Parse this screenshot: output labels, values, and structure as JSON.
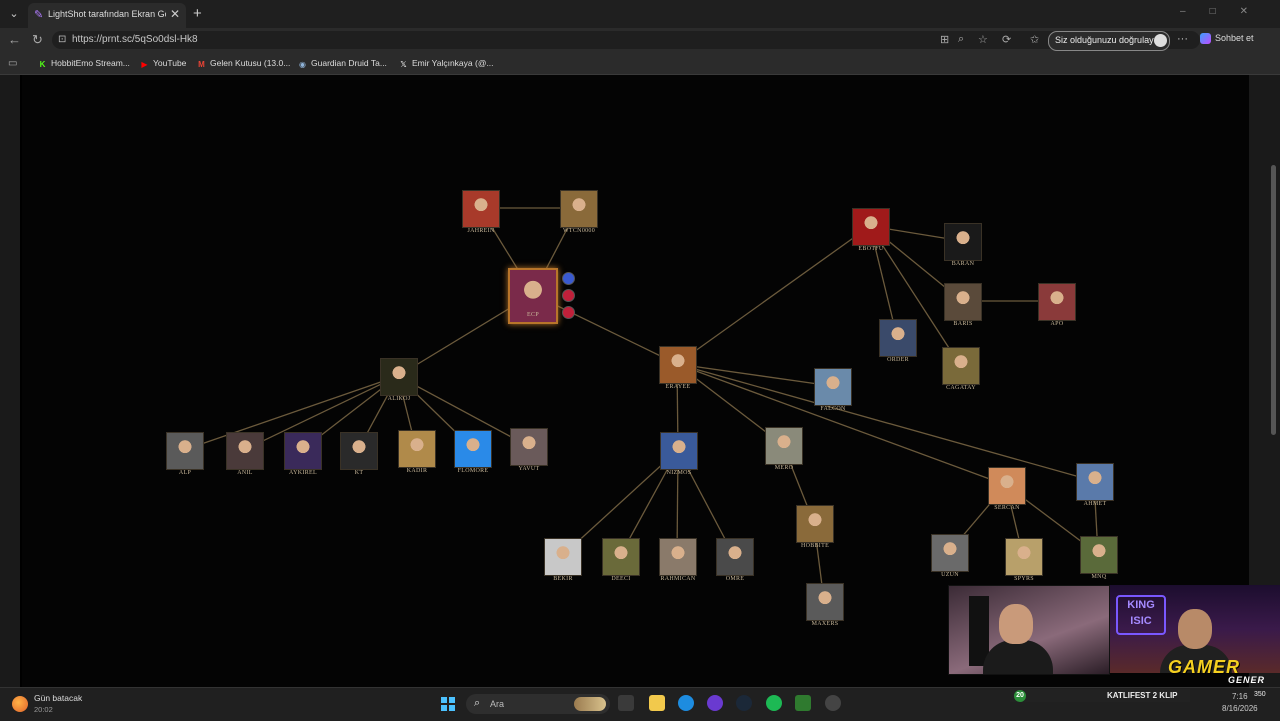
{
  "browser": {
    "tab_title": "LightShot tarafından Ekran Görüntüsü",
    "url": "https://prnt.sc/5qSo0dsl-Hk8",
    "profile_prompt": "Siz olduğunuzu doğrulayın",
    "copilot_label": "Sohbet et"
  },
  "bookmarks": [
    {
      "label": "HobbitEmo Stream...",
      "icon": "kick-icon",
      "color": "#53fc18"
    },
    {
      "label": "YouTube",
      "icon": "youtube-icon",
      "color": "#ff0000"
    },
    {
      "label": "Gelen Kutusu (13.0...",
      "icon": "gmail-icon",
      "color": "#ea4335"
    },
    {
      "label": "Guardian Druid Ta...",
      "icon": "guardian-icon",
      "color": "#8fb3d9"
    },
    {
      "label": "Emir Yalçınkaya (@...",
      "icon": "x-icon",
      "color": "#ffffff"
    }
  ],
  "graph": {
    "nodes": [
      {
        "id": "jahrein",
        "label": "JAHREIN",
        "color": "#a83a2a"
      },
      {
        "id": "wtcn",
        "label": "WTCN0000",
        "color": "#8a6a3a"
      },
      {
        "id": "ecp",
        "label": "ECP",
        "color": "#7a2a4a",
        "root": true
      },
      {
        "id": "alikoj",
        "label": "ALIKOJ",
        "color": "#2a2a1a"
      },
      {
        "id": "eray",
        "label": "ERAYEE",
        "color": "#9a5a2a"
      },
      {
        "id": "ebotfu",
        "label": "EBOTFU",
        "color": "#a01a1a"
      },
      {
        "id": "baran",
        "label": "BARAN",
        "color": "#1a1a1a"
      },
      {
        "id": "baris",
        "label": "BARIS",
        "color": "#5a4a3a"
      },
      {
        "id": "apo",
        "label": "APO",
        "color": "#8a3a3a"
      },
      {
        "id": "order",
        "label": "ORDER",
        "color": "#3a4a6a"
      },
      {
        "id": "cagatay",
        "label": "CAGATAY",
        "color": "#7a6a3a"
      },
      {
        "id": "falcon",
        "label": "FALCON",
        "color": "#6a8aaa"
      },
      {
        "id": "alp",
        "label": "ALP",
        "color": "#5a5a5a"
      },
      {
        "id": "anil",
        "label": "ANIL",
        "color": "#4a3a3a"
      },
      {
        "id": "aykirel",
        "label": "AYKIREL",
        "color": "#3a2a5a"
      },
      {
        "id": "kt",
        "label": "KT",
        "color": "#2a2a2a"
      },
      {
        "id": "kadir",
        "label": "KADIR",
        "color": "#b08a4a"
      },
      {
        "id": "flomore",
        "label": "FLOMORE",
        "color": "#2a8ae8"
      },
      {
        "id": "yavut",
        "label": "YAVUT",
        "color": "#6a5a5a"
      },
      {
        "id": "nizmos",
        "label": "NIZMOS",
        "color": "#3a5a9a"
      },
      {
        "id": "mero",
        "label": "MERO",
        "color": "#8a8a7a"
      },
      {
        "id": "sercan",
        "label": "SERCAN",
        "color": "#d08a5a"
      },
      {
        "id": "ahmet",
        "label": "AHMET",
        "color": "#5a7aaa"
      },
      {
        "id": "hobbit",
        "label": "HOBBITE",
        "color": "#8a6a3a"
      },
      {
        "id": "maxers",
        "label": "MAXERS",
        "color": "#5a5a5a"
      },
      {
        "id": "bekir",
        "label": "BEKIR",
        "color": "#c8c8c8"
      },
      {
        "id": "deeci",
        "label": "DEECI",
        "color": "#6a6a3a"
      },
      {
        "id": "rahmican",
        "label": "RAHMICAN",
        "color": "#8a7a6a"
      },
      {
        "id": "omre",
        "label": "OMRE",
        "color": "#4a4a4a"
      },
      {
        "id": "uzun",
        "label": "UZUN",
        "color": "#6a6a6a"
      },
      {
        "id": "spyrs",
        "label": "SPYRS",
        "color": "#b8a06a"
      },
      {
        "id": "mnq",
        "label": "MNQ",
        "color": "#5a6a3a"
      }
    ],
    "edges": [
      [
        "jahrein",
        "ecp"
      ],
      [
        "wtcn",
        "ecp"
      ],
      [
        "jahrein",
        "wtcn"
      ],
      [
        "ecp",
        "alikoj"
      ],
      [
        "ecp",
        "eray"
      ],
      [
        "eray",
        "ebotfu"
      ],
      [
        "ebotfu",
        "baran"
      ],
      [
        "ebotfu",
        "baris"
      ],
      [
        "ebotfu",
        "order"
      ],
      [
        "ebotfu",
        "cagatay"
      ],
      [
        "baris",
        "apo"
      ],
      [
        "eray",
        "falcon"
      ],
      [
        "eray",
        "nizmos"
      ],
      [
        "eray",
        "mero"
      ],
      [
        "eray",
        "sercan"
      ],
      [
        "eray",
        "ahmet"
      ],
      [
        "alikoj",
        "alp"
      ],
      [
        "alikoj",
        "anil"
      ],
      [
        "alikoj",
        "aykirel"
      ],
      [
        "alikoj",
        "kt"
      ],
      [
        "alikoj",
        "kadir"
      ],
      [
        "alikoj",
        "flomore"
      ],
      [
        "alikoj",
        "yavut"
      ],
      [
        "nizmos",
        "bekir"
      ],
      [
        "nizmos",
        "deeci"
      ],
      [
        "nizmos",
        "rahmican"
      ],
      [
        "nizmos",
        "omre"
      ],
      [
        "mero",
        "hobbit"
      ],
      [
        "hobbit",
        "maxers"
      ],
      [
        "sercan",
        "uzun"
      ],
      [
        "sercan",
        "spyrs"
      ],
      [
        "sercan",
        "mnq"
      ],
      [
        "ahmet",
        "mnq"
      ]
    ],
    "root_badges": [
      "#3a5ad0",
      "#c0203a",
      "#c0203a"
    ]
  },
  "taskbar": {
    "weather_title": "Gün batacak",
    "weather_time": "20:02",
    "search_placeholder": "Ara",
    "time": "7:16",
    "date": "8/16/2026"
  },
  "stream": {
    "clip_count": "20",
    "clip_text": "KATLIFEST 2 KLIP",
    "brand_main": "GAMER",
    "brand_sub": "GENER",
    "neon_sign": "KING ISIC",
    "viewer_count": "350"
  }
}
